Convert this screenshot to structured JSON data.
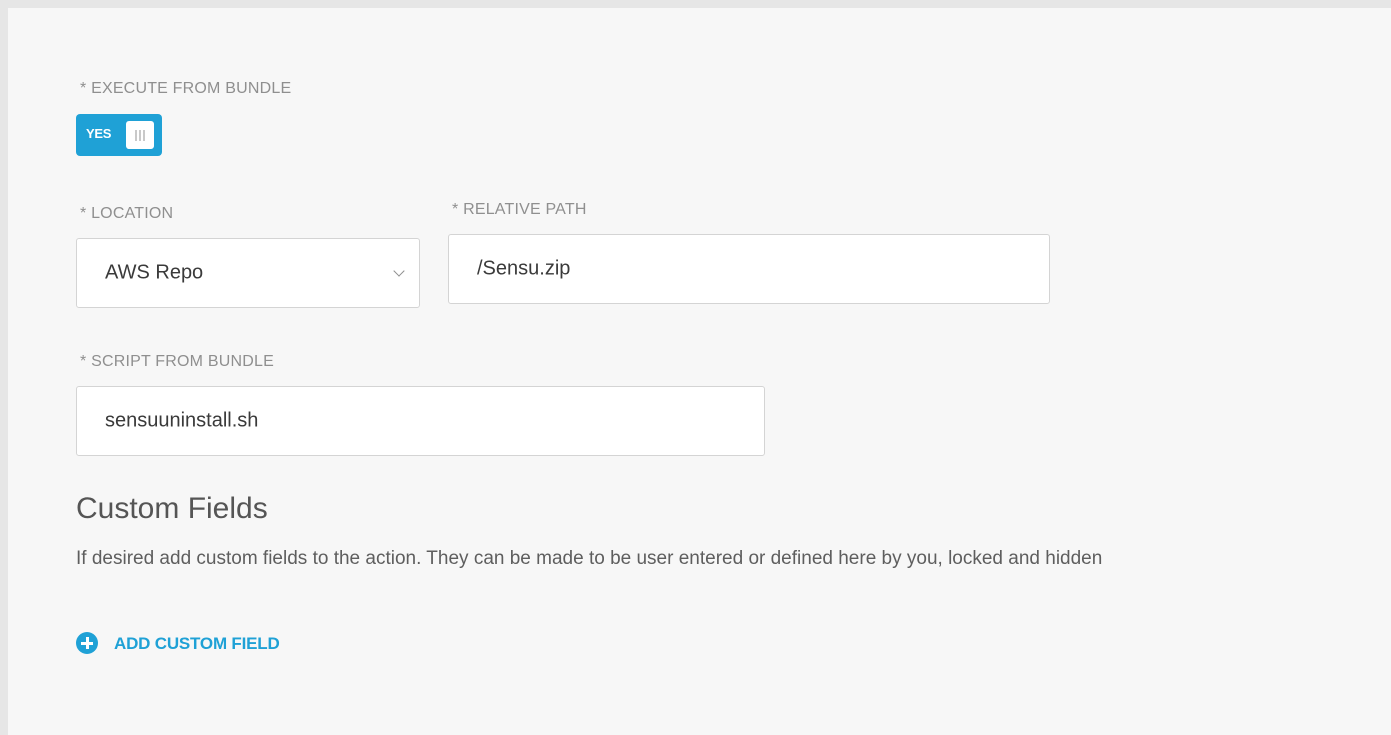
{
  "form": {
    "execute_from_bundle": {
      "label": "* EXECUTE FROM BUNDLE",
      "toggle_text": "YES",
      "toggle_color": "#1fa1d6",
      "enabled": true
    },
    "location": {
      "label": "* LOCATION",
      "value": "AWS Repo"
    },
    "relative_path": {
      "label": "* RELATIVE PATH",
      "value": "/Sensu.zip"
    },
    "script_from_bundle": {
      "label": "* SCRIPT FROM BUNDLE",
      "value": "sensuuninstall.sh"
    }
  },
  "custom_fields": {
    "title": "Custom Fields",
    "description": "If desired add custom fields to the action. They can be made to be user entered or defined here by you, locked and hidden",
    "add_label": "ADD CUSTOM FIELD",
    "add_icon": "plus-circle-icon",
    "accent_color": "#1fa1d6"
  }
}
